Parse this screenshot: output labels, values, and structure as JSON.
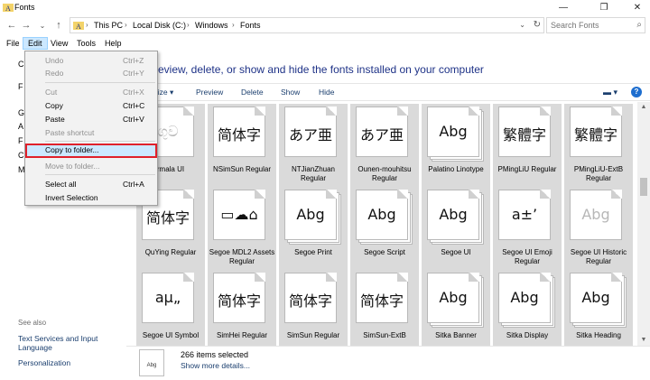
{
  "window": {
    "title": "Fonts",
    "controls": {
      "minimize": "—",
      "maximize": "❐",
      "close": "✕"
    }
  },
  "address": {
    "crumbs": [
      "This PC",
      "Local Disk (C:)",
      "Windows",
      "Fonts"
    ],
    "search_placeholder": "Search Fonts"
  },
  "menubar": {
    "items": [
      "File",
      "Edit",
      "View",
      "Tools",
      "Help"
    ],
    "active": "Edit"
  },
  "edit_menu": {
    "items": [
      {
        "label": "Undo",
        "shortcut": "Ctrl+Z",
        "enabled": false
      },
      {
        "label": "Redo",
        "shortcut": "Ctrl+Y",
        "enabled": false
      },
      {
        "label": "Cut",
        "shortcut": "Ctrl+X",
        "enabled": false
      },
      {
        "label": "Copy",
        "shortcut": "Ctrl+C",
        "enabled": true
      },
      {
        "label": "Paste",
        "shortcut": "Ctrl+V",
        "enabled": true
      },
      {
        "label": "Paste shortcut",
        "shortcut": "",
        "enabled": false
      },
      {
        "label": "Copy to folder...",
        "shortcut": "",
        "enabled": true,
        "highlighted": true
      },
      {
        "label": "Move to folder...",
        "shortcut": "",
        "enabled": false
      },
      {
        "label": "Select all",
        "shortcut": "Ctrl+A",
        "enabled": true
      },
      {
        "label": "Invert Selection",
        "shortcut": "",
        "enabled": true
      }
    ]
  },
  "leftpane": {
    "letters": [
      "C",
      "F",
      "G",
      "A",
      "F",
      "C",
      "M"
    ],
    "see_also_label": "See also",
    "links": [
      "Text Services and Input Language",
      "Personalization"
    ]
  },
  "content": {
    "heading": "eview, delete, or show and hide the fonts installed on your computer",
    "toolbar": {
      "organize": "nize ▾",
      "preview": "Preview",
      "delete": "Delete",
      "show": "Show",
      "hide": "Hide",
      "view_icon": "▬ ▾",
      "help_icon": "?"
    }
  },
  "fonts": [
    {
      "name": "rmala UI",
      "sample": "ගුව",
      "grey": true,
      "stack": 1
    },
    {
      "name": "NSimSun Regular",
      "sample": "简体字",
      "grey": false,
      "stack": 1
    },
    {
      "name": "NTJianZhuan Regular",
      "sample": "あア亜",
      "grey": false,
      "stack": 1
    },
    {
      "name": "Ounen-mouhitsu Regular",
      "sample": "あア亜",
      "grey": false,
      "stack": 1
    },
    {
      "name": "Palatino Linotype",
      "sample": "Abg",
      "grey": false,
      "stack": 3
    },
    {
      "name": "PMingLiU Regular",
      "sample": "繁體字",
      "grey": false,
      "stack": 1
    },
    {
      "name": "PMingLiU-ExtB Regular",
      "sample": "繁體字",
      "grey": false,
      "stack": 1
    },
    {
      "name": "QuYing Regular",
      "sample": "简体字",
      "grey": false,
      "stack": 1
    },
    {
      "name": "Segoe MDL2 Assets Regular",
      "sample": "▭☁⌂",
      "grey": false,
      "stack": 1
    },
    {
      "name": "Segoe Print",
      "sample": "Abg",
      "grey": false,
      "stack": 3
    },
    {
      "name": "Segoe Script",
      "sample": "Abg",
      "grey": false,
      "stack": 3
    },
    {
      "name": "Segoe UI",
      "sample": "Abg",
      "grey": false,
      "stack": 3
    },
    {
      "name": "Segoe UI Emoji Regular",
      "sample": "a±’",
      "grey": false,
      "stack": 1
    },
    {
      "name": "Segoe UI Historic Regular",
      "sample": "Abg",
      "grey": true,
      "stack": 1
    },
    {
      "name": "Segoe UI Symbol",
      "sample": "aμ„",
      "grey": false,
      "stack": 1
    },
    {
      "name": "SimHei Regular",
      "sample": "简体字",
      "grey": false,
      "stack": 1
    },
    {
      "name": "SimSun Regular",
      "sample": "简体字",
      "grey": false,
      "stack": 1
    },
    {
      "name": "SimSun-ExtB",
      "sample": "简体字",
      "grey": false,
      "stack": 1
    },
    {
      "name": "Sitka Banner",
      "sample": "Abg",
      "grey": false,
      "stack": 3
    },
    {
      "name": "Sitka Display",
      "sample": "Abg",
      "grey": false,
      "stack": 3
    },
    {
      "name": "Sitka Heading",
      "sample": "Abg",
      "grey": false,
      "stack": 3
    }
  ],
  "details": {
    "thumb_text": "Abg",
    "count": "266 items selected",
    "more": "Show more details..."
  }
}
